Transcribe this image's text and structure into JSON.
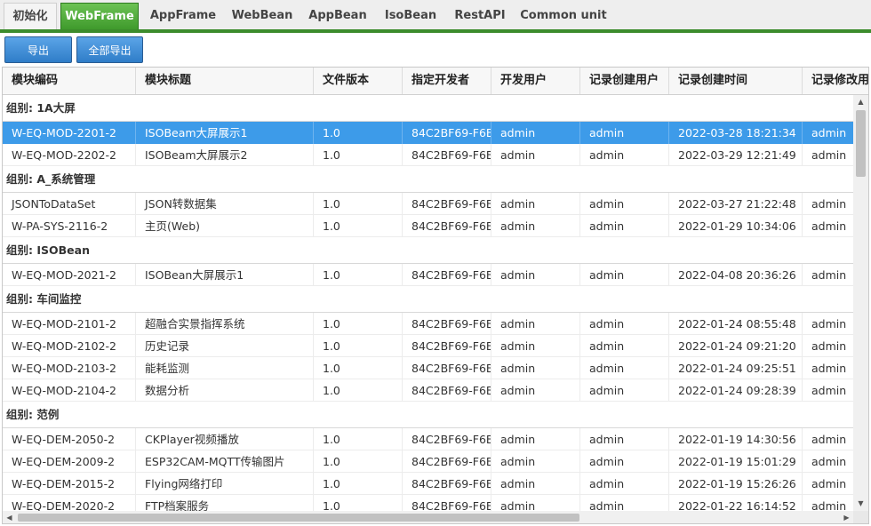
{
  "tabs": [
    "初始化",
    "WebFrame",
    "AppFrame",
    "WebBean",
    "AppBean",
    "IsoBean",
    "RestAPI",
    "Common unit"
  ],
  "toolbar": {
    "export_label": "导出",
    "export_all_label": "全部导出"
  },
  "columns": [
    "模块编码",
    "模块标题",
    "文件版本",
    "指定开发者",
    "开发用户",
    "记录创建用户",
    "记录创建时间",
    "记录修改用户"
  ],
  "groups": [
    {
      "title": "组别: 1A大屏",
      "rows": [
        [
          "W-EQ-MOD-2201-2",
          "ISOBeam大屏展示1",
          "1.0",
          "84C2BF69-F6B",
          "admin",
          "admin",
          "2022-03-28 18:21:34",
          "admin"
        ],
        [
          "W-EQ-MOD-2202-2",
          "ISOBeam大屏展示2",
          "1.0",
          "84C2BF69-F6B",
          "admin",
          "admin",
          "2022-03-29 12:21:49",
          "admin"
        ]
      ]
    },
    {
      "title": "组别: A_系统管理",
      "rows": [
        [
          "JSONToDataSet",
          "JSON转数据集",
          "1.0",
          "84C2BF69-F6B",
          "admin",
          "admin",
          "2022-03-27 21:22:48",
          "admin"
        ],
        [
          "W-PA-SYS-2116-2",
          "主页(Web)",
          "1.0",
          "84C2BF69-F6B",
          "admin",
          "admin",
          "2022-01-29 10:34:06",
          "admin"
        ]
      ]
    },
    {
      "title": "组别: ISOBean",
      "rows": [
        [
          "W-EQ-MOD-2021-2",
          "ISOBean大屏展示1",
          "1.0",
          "84C2BF69-F6B",
          "admin",
          "admin",
          "2022-04-08 20:36:26",
          "admin"
        ]
      ]
    },
    {
      "title": "组别: 车间监控",
      "rows": [
        [
          "W-EQ-MOD-2101-2",
          "超融合实景指挥系统",
          "1.0",
          "84C2BF69-F6B",
          "admin",
          "admin",
          "2022-01-24 08:55:48",
          "admin"
        ],
        [
          "W-EQ-MOD-2102-2",
          "历史记录",
          "1.0",
          "84C2BF69-F6B",
          "admin",
          "admin",
          "2022-01-24 09:21:20",
          "admin"
        ],
        [
          "W-EQ-MOD-2103-2",
          "能耗监测",
          "1.0",
          "84C2BF69-F6B",
          "admin",
          "admin",
          "2022-01-24 09:25:51",
          "admin"
        ],
        [
          "W-EQ-MOD-2104-2",
          "数据分析",
          "1.0",
          "84C2BF69-F6B",
          "admin",
          "admin",
          "2022-01-24 09:28:39",
          "admin"
        ]
      ]
    },
    {
      "title": "组别: 范例",
      "rows": [
        [
          "W-EQ-DEM-2050-2",
          "CKPlayer视频播放",
          "1.0",
          "84C2BF69-F6B",
          "admin",
          "admin",
          "2022-01-19 14:30:56",
          "admin"
        ],
        [
          "W-EQ-DEM-2009-2",
          "ESP32CAM-MQTT传输图片",
          "1.0",
          "84C2BF69-F6B",
          "admin",
          "admin",
          "2022-01-19 15:01:29",
          "admin"
        ],
        [
          "W-EQ-DEM-2015-2",
          "Flying网络打印",
          "1.0",
          "84C2BF69-F6B",
          "admin",
          "admin",
          "2022-01-19 15:26:26",
          "admin"
        ],
        [
          "W-EQ-DEM-2020-2",
          "FTP档案服务",
          "1.0",
          "84C2BF69-F6B",
          "admin",
          "admin",
          "2022-01-22 16:14:52",
          "admin"
        ]
      ]
    }
  ],
  "selected_row": "W-EQ-MOD-2201-2",
  "colors": {
    "tab_active": "#4aa436",
    "tab_line": "#3c8c2c",
    "button": "#3a8ad6",
    "row_selected": "#3d9be9"
  },
  "icons": {
    "scroll_up": "▲",
    "scroll_down": "▼",
    "scroll_left": "◀",
    "scroll_right": "▶"
  }
}
